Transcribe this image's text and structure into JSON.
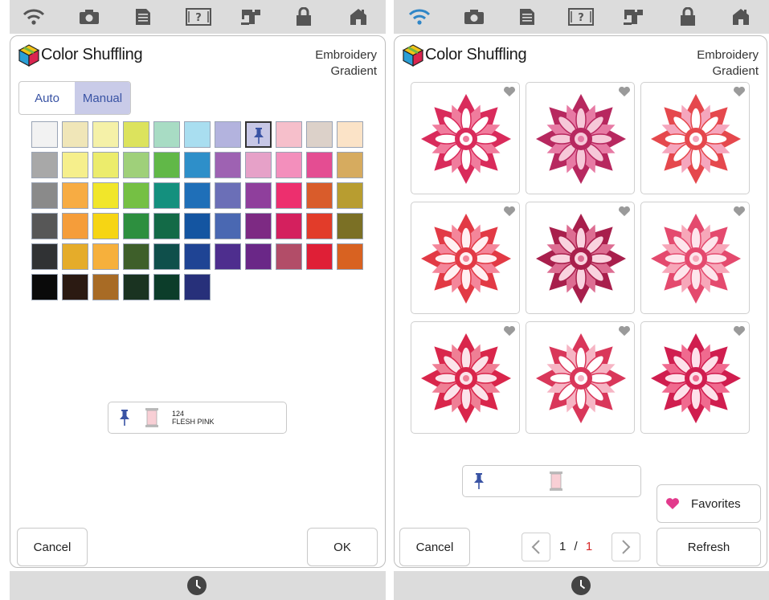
{
  "left": {
    "title": "Color Shuffling",
    "mode_line1": "Embroidery",
    "mode_line2": "Gradient",
    "tabs": [
      "Auto",
      "Manual"
    ],
    "active_tab": "Manual",
    "palette": [
      [
        "#f2f2f2",
        "#f0e6b8",
        "#f5f1a8",
        "#dce35d",
        "#a8dcc4",
        "#a9def0",
        "#b3b3de",
        "#c7c7e6",
        "#f6bfcb",
        "#dcd1c9",
        "#fbe3c7"
      ],
      [
        "#a8a8a8",
        "#f6ef8c",
        "#ecec6c",
        "#9fd07a",
        "#61b848",
        "#2e8fc9",
        "#9e62b2",
        "#e6a1c8",
        "#f38fbc",
        "#e44d92",
        "#d6ab5f"
      ],
      [
        "#8a8a8a",
        "#f7ac43",
        "#f1e62a",
        "#75c044",
        "#14907e",
        "#1f6fb8",
        "#6b6fb7",
        "#8f3f9c",
        "#ed2f6e",
        "#d95c2b",
        "#b89d30"
      ],
      [
        "#575757",
        "#f59d3a",
        "#f6d514",
        "#2d8f3f",
        "#136a47",
        "#1455a1",
        "#4a68b2",
        "#7d2a83",
        "#d4205e",
        "#e23c2a",
        "#7b7025"
      ],
      [
        "#303234",
        "#e5ac2a",
        "#f6b03c",
        "#3e5f2a",
        "#0f4f4b",
        "#1f4494",
        "#4e2e8e",
        "#6a2787",
        "#b24d68",
        "#df1f36",
        "#d86221"
      ],
      [
        "#0a0a0a",
        "#2b1a12",
        "#a86b25",
        "#1a3321",
        "#0c3d2a",
        "#27307a"
      ]
    ],
    "selected_swatch": "1,7",
    "thread_number": "124",
    "thread_name": "FLESH PINK",
    "thread_color": "#f8cfd5",
    "cancel_label": "Cancel",
    "ok_label": "OK"
  },
  "right": {
    "title": "Color Shuffling",
    "mode_line1": "Embroidery",
    "mode_line2": "Gradient",
    "thread_color": "#f8cfd5",
    "favorites_label": "Favorites",
    "cancel_label": "Cancel",
    "refresh_label": "Refresh",
    "page_current": "1",
    "page_sep": "/",
    "page_total": "1",
    "designs": [
      {
        "c1": "#d92b5b",
        "c2": "#f07c9d",
        "c3": "#ffffff"
      },
      {
        "c1": "#b7285f",
        "c2": "#e77aa4",
        "c3": "#f6c8d8"
      },
      {
        "c1": "#e5484d",
        "c2": "#f5a6bd",
        "c3": "#ffffff"
      },
      {
        "c1": "#e23a45",
        "c2": "#f4869a",
        "c3": "#fff0f2"
      },
      {
        "c1": "#a81f4c",
        "c2": "#dd6d92",
        "c3": "#f9d3df"
      },
      {
        "c1": "#e44a6e",
        "c2": "#f7a7b9",
        "c3": "#fde6ec"
      },
      {
        "c1": "#d9264b",
        "c2": "#ef7f95",
        "c3": "#fbe4ea"
      },
      {
        "c1": "#d9375a",
        "c2": "#f6b5c4",
        "c3": "#ffffff"
      },
      {
        "c1": "#d01e4f",
        "c2": "#f06a8f",
        "c3": "#fde1ea"
      }
    ]
  },
  "colors": {
    "accent": "#3953a4",
    "page_total_color": "#d62828",
    "heart_favorite": "#e23a8c",
    "heart_grey": "#9a9a9a"
  },
  "icons": [
    "wifi-icon",
    "camera-icon",
    "document-icon",
    "help-icon",
    "sewing-machine-icon",
    "lock-icon",
    "home-icon",
    "clock-icon",
    "pin-icon",
    "thread-spool-icon",
    "heart-icon",
    "chevron-left-icon",
    "chevron-right-icon",
    "color-cube-logo"
  ]
}
